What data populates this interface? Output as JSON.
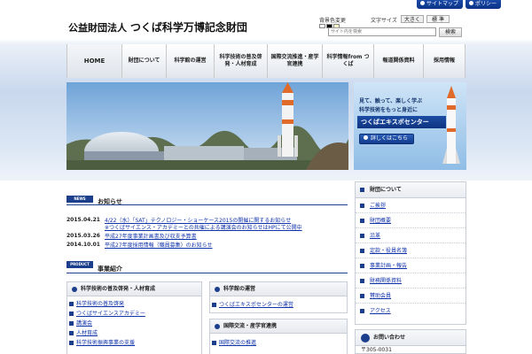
{
  "topbar": {
    "sitemap": "サイトマップ",
    "policy": "ポリシー"
  },
  "header": {
    "logo_sub": "公益財団法人",
    "logo_main": "つくば科学万博記念財団",
    "bg_label": "背景色変更",
    "bg_colors": [
      "#ffffff",
      "#000000",
      "#ffffcc"
    ],
    "font_label": "文字サイズ",
    "font_large": "大きく",
    "font_std": "標 準",
    "search_placeholder": "サイト内を検索",
    "search_button": "検索"
  },
  "nav": {
    "items": [
      "HOME",
      "財団について",
      "科学館の運営",
      "科学技術の普及啓発・人材育成",
      "国際交流推進・産学官連携",
      "科学情報from つくば",
      "報道関係資料",
      "採用情報"
    ]
  },
  "promo": {
    "line1": "見て、触って、楽しく学ぶ",
    "line2": "科学技術をもっと身近に",
    "title": "つくばエキスポセンター",
    "button": "詳しくはこちら"
  },
  "news": {
    "tag": "NEWS",
    "title": "お知らせ",
    "items": [
      {
        "date": "2015.04.21",
        "text": "4/22（水）「SAT」テクノロジー・ショーケース2015の開催に関するお知らせ"
      },
      {
        "date": "",
        "text": "※つくばサイエンス・アカデミーとの共催による講演会のお知らせはHPにて公開中"
      },
      {
        "date": "2015.03.26",
        "text": "平成27年度事業計画書及び収支予算書"
      },
      {
        "date": "2014.10.01",
        "text": "平成27年度採用情報（職員募集）のお知らせ"
      }
    ]
  },
  "product": {
    "tag": "PRODUCT",
    "title": "事業紹介"
  },
  "box_left": {
    "title": "科学技術の普及啓発・人材育成",
    "links": [
      "科学技術の普及啓発",
      "つくばサイエンスアカデミー",
      "講演会",
      "人材育成",
      "科学技術振興事業の支援"
    ]
  },
  "box_mid1": {
    "title": "科学館の運営",
    "links": [
      "つくばエキスポセンターの運営"
    ]
  },
  "box_mid2": {
    "title": "国際交流・産学官連携",
    "links": [
      "国際交流の推進"
    ]
  },
  "side": {
    "head": "財団について",
    "items": [
      "ご挨拶",
      "財団概要",
      "沿革",
      "定款・役員名簿",
      "事業計画・報告",
      "財務関係資料",
      "賛助会員",
      "アクセス"
    ]
  },
  "contact": {
    "title": "お問い合わせ",
    "line1": "〒305-0031"
  }
}
